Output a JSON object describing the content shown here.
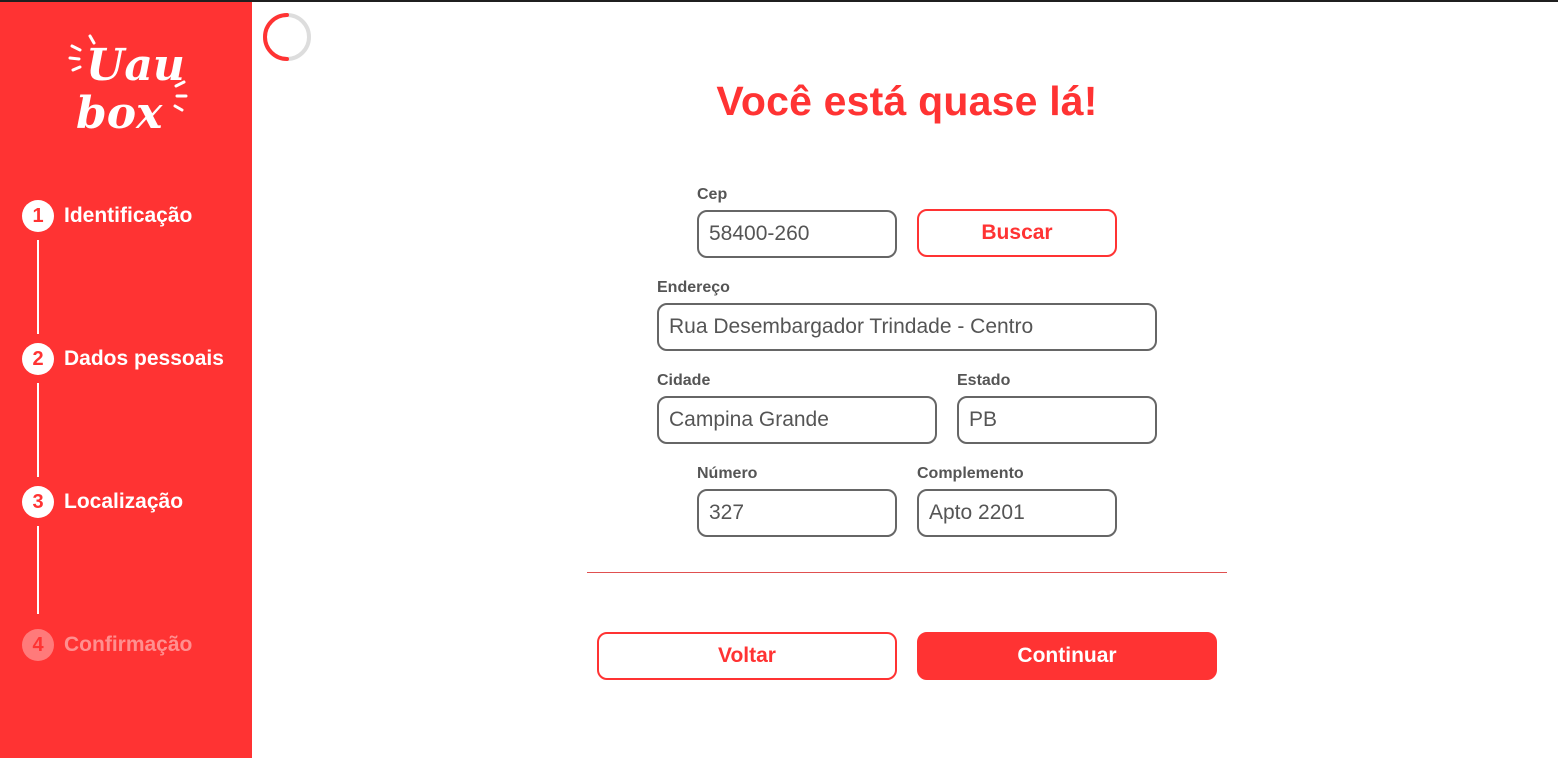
{
  "brand": {
    "logo_text_line1": "Uau",
    "logo_text_line2": "box",
    "accent_color": "#ff3333"
  },
  "steps": [
    {
      "number": "1",
      "label": "Identificação",
      "active": true
    },
    {
      "number": "2",
      "label": "Dados pessoais",
      "active": true
    },
    {
      "number": "3",
      "label": "Localização",
      "active": true
    },
    {
      "number": "4",
      "label": "Confirmação",
      "active": false
    }
  ],
  "page": {
    "title": "Você está quase lá!"
  },
  "form": {
    "cep": {
      "label": "Cep",
      "value": "58400-260"
    },
    "buscar_label": "Buscar",
    "endereco": {
      "label": "Endereço",
      "value": "Rua Desembargador Trindade - Centro"
    },
    "cidade": {
      "label": "Cidade",
      "value": "Campina Grande"
    },
    "estado": {
      "label": "Estado",
      "value": "PB"
    },
    "numero": {
      "label": "Número",
      "value": "327"
    },
    "complemento": {
      "label": "Complemento",
      "value": "Apto 2201"
    }
  },
  "actions": {
    "back_label": "Voltar",
    "continue_label": "Continuar"
  },
  "icons": {
    "spinner": "loading-spinner-icon"
  }
}
